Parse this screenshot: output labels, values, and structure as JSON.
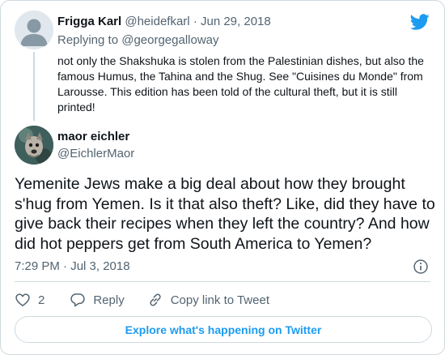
{
  "parent_tweet": {
    "name": "Frigga Karl",
    "handle": "@heidefkarl",
    "separator": "·",
    "date": "Jun 29, 2018",
    "replying_to_label": "Replying to",
    "replying_to_handle": "@georgegalloway",
    "text": "not only the Shakshuka is stolen from the Palestinian dishes, but also the famous Humus, the Tahina and the Shug. See \"Cuisines du Monde\" from Larousse. This edition has been told of the cultural theft, but it is still printed!"
  },
  "main_tweet": {
    "name": "maor eichler",
    "handle": "@EichlerMaor",
    "text": "Yemenite Jews make a big deal about how they brought s'hug from Yemen. Is it that also theft? Like, did they have to give back their recipes when they left the country? And how did hot peppers get from South America to Yemen?",
    "timestamp": "7:29 PM · Jul 3, 2018"
  },
  "actions": {
    "like_count": "2",
    "reply_label": "Reply",
    "copy_link_label": "Copy link to Tweet"
  },
  "explore_button_label": "Explore what's happening on Twitter",
  "colors": {
    "accent": "#1d9bf0",
    "text_primary": "#0f1419",
    "text_secondary": "#536471",
    "border": "#cfd9de"
  },
  "icons": [
    "twitter-bird-icon",
    "info-icon",
    "heart-icon",
    "reply-bubble-icon",
    "link-icon"
  ]
}
